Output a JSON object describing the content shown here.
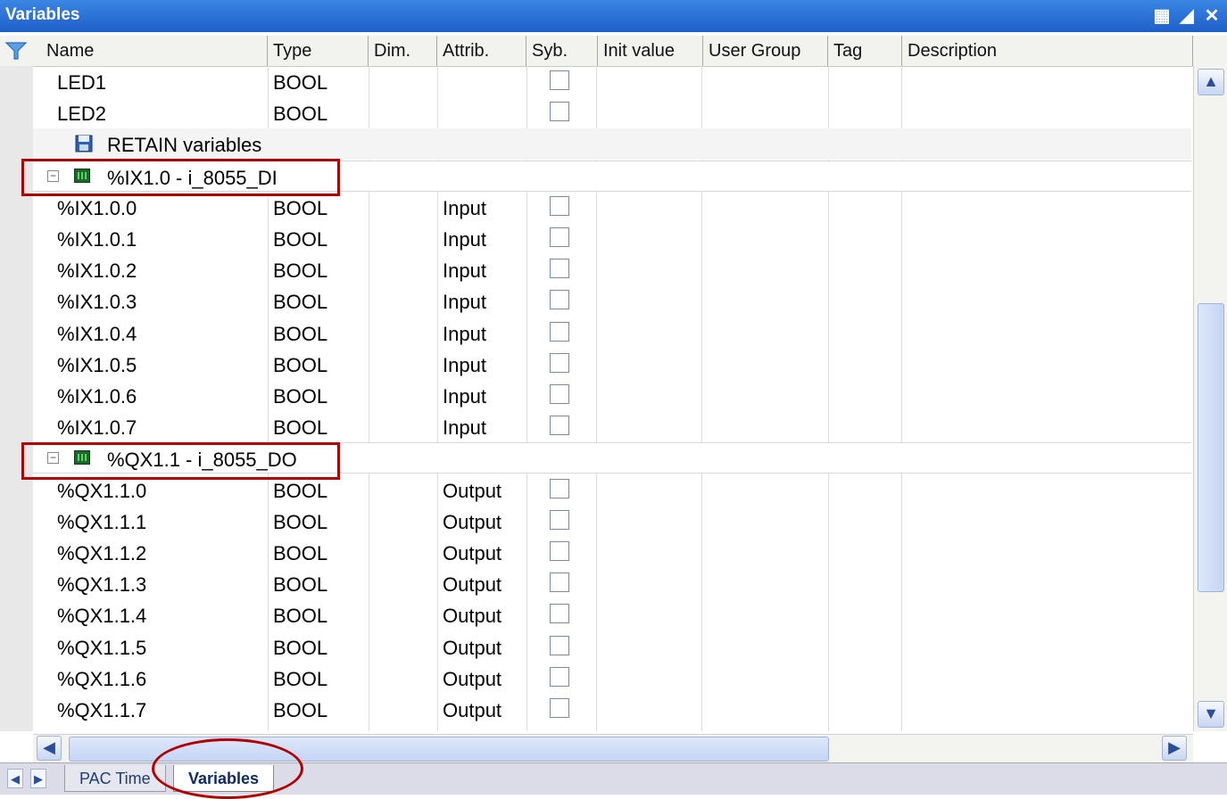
{
  "window": {
    "title": "Variables"
  },
  "columns": [
    "Name",
    "Type",
    "Dim.",
    "Attrib.",
    "Syb.",
    "Init value",
    "User Group",
    "Tag",
    "Description"
  ],
  "rows_top": [
    {
      "name": "LED1",
      "type": "BOOL",
      "attrib": ""
    },
    {
      "name": "LED2",
      "type": "BOOL",
      "attrib": ""
    }
  ],
  "retain_label": "RETAIN variables",
  "group_di": {
    "label": "%IX1.0 - i_8055_DI",
    "rows": [
      {
        "name": "%IX1.0.0",
        "type": "BOOL",
        "attrib": "Input"
      },
      {
        "name": "%IX1.0.1",
        "type": "BOOL",
        "attrib": "Input"
      },
      {
        "name": "%IX1.0.2",
        "type": "BOOL",
        "attrib": "Input"
      },
      {
        "name": "%IX1.0.3",
        "type": "BOOL",
        "attrib": "Input"
      },
      {
        "name": "%IX1.0.4",
        "type": "BOOL",
        "attrib": "Input"
      },
      {
        "name": "%IX1.0.5",
        "type": "BOOL",
        "attrib": "Input"
      },
      {
        "name": "%IX1.0.6",
        "type": "BOOL",
        "attrib": "Input"
      },
      {
        "name": "%IX1.0.7",
        "type": "BOOL",
        "attrib": "Input"
      }
    ]
  },
  "group_do": {
    "label": "%QX1.1 - i_8055_DO",
    "rows": [
      {
        "name": "%QX1.1.0",
        "type": "BOOL",
        "attrib": "Output"
      },
      {
        "name": "%QX1.1.1",
        "type": "BOOL",
        "attrib": "Output"
      },
      {
        "name": "%QX1.1.2",
        "type": "BOOL",
        "attrib": "Output"
      },
      {
        "name": "%QX1.1.3",
        "type": "BOOL",
        "attrib": "Output"
      },
      {
        "name": "%QX1.1.4",
        "type": "BOOL",
        "attrib": "Output"
      },
      {
        "name": "%QX1.1.5",
        "type": "BOOL",
        "attrib": "Output"
      },
      {
        "name": "%QX1.1.6",
        "type": "BOOL",
        "attrib": "Output"
      },
      {
        "name": "%QX1.1.7",
        "type": "BOOL",
        "attrib": "Output"
      }
    ]
  },
  "tabs": [
    {
      "label": "PAC Time",
      "active": false
    },
    {
      "label": "Variables",
      "active": true
    }
  ],
  "colors": {
    "title_bar": "#1e5fc9",
    "highlight": "#b00000"
  }
}
